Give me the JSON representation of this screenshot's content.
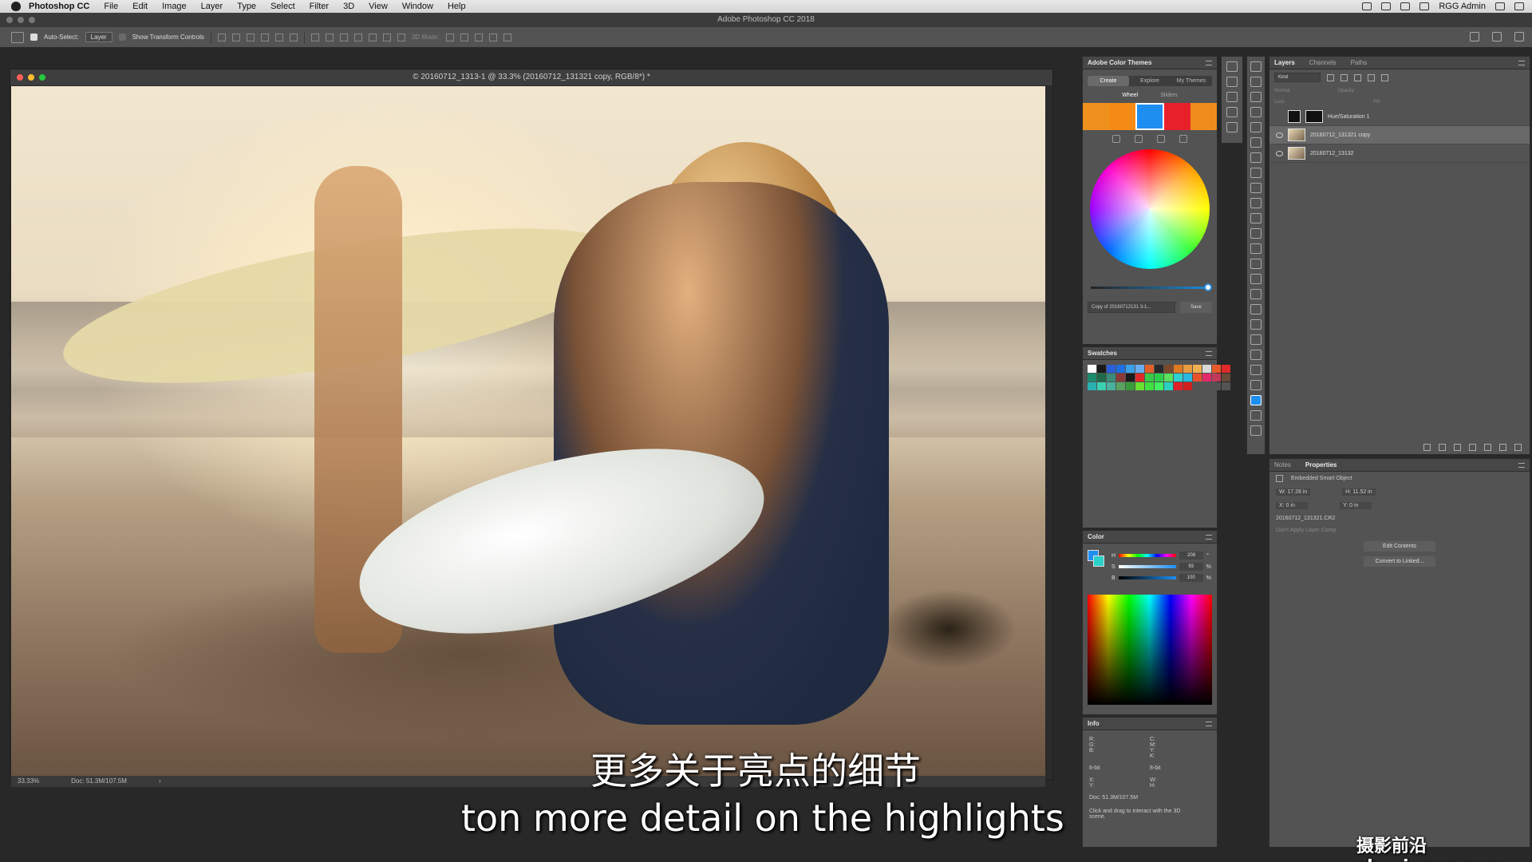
{
  "menubar": {
    "app_name": "Photoshop CC",
    "items": [
      "File",
      "Edit",
      "Image",
      "Layer",
      "Type",
      "Select",
      "Filter",
      "3D",
      "View",
      "Window",
      "Help"
    ],
    "user": "RGG Admin"
  },
  "window": {
    "title": "Adobe Photoshop CC 2018"
  },
  "options": {
    "auto_select_label": "Auto-Select:",
    "auto_select_value": "Layer",
    "transform_label": "Show Transform Controls",
    "mode_3d": "3D Mode:"
  },
  "document": {
    "title": "© 20160712_1313-1 @ 33.3% (20160712_131321 copy, RGB/8*) *",
    "zoom": "33.33%",
    "doc_size": "Doc: 51.3M/107.5M"
  },
  "subtitles": {
    "zh": "更多关于亮点的细节",
    "en": "ton more detail on the highlights",
    "watermark": "摄影前沿 sheyingyz.com"
  },
  "color_themes": {
    "title": "Adobe Color Themes",
    "tabs": [
      "Create",
      "Explore",
      "My Themes"
    ],
    "modes": [
      "Wheel",
      "Sliders"
    ],
    "theme_colors": [
      "#f0901e",
      "#f58a14",
      "#1e8ef0",
      "#e8202a",
      "#f08c1e"
    ],
    "theme_name": "Copy of 20160712131 3-1...",
    "save_label": "Save"
  },
  "swatches": {
    "title": "Swatches",
    "colors": [
      "#ffffff",
      "#1a1a1a",
      "#2b5fd9",
      "#1e6fe0",
      "#3aa0e8",
      "#6aaef0",
      "#e0622a",
      "#2a2a2a",
      "#7a4a2a",
      "#e07a20",
      "#e89a40",
      "#f0b050",
      "#d9d9d9",
      "#e85a2a",
      "#e02a2a",
      "#1a8a6a",
      "#1e6a4a",
      "#3a8a7a",
      "#8a3a3a",
      "#1a1a1a",
      "#e02a2a",
      "#3ac84a",
      "#2ad04a",
      "#5ae05a",
      "#30d0d0",
      "#28b8e0",
      "#e8502a",
      "#e02a6a",
      "#c03a5a",
      "#6a4a3a",
      "#2ab0b0",
      "#3ad0b0",
      "#4ab0a0",
      "#5aa060",
      "#3a9a3a",
      "#6ae030",
      "#40e040",
      "#40f060",
      "#2ad0c0",
      "#e0202a",
      "#d02020",
      "#535353",
      "#535353",
      "#535353",
      "#535353"
    ]
  },
  "color_panel": {
    "title": "Color",
    "rows": [
      {
        "label": "H",
        "value": "208",
        "unit": "°"
      },
      {
        "label": "S",
        "value": "93",
        "unit": "%"
      },
      {
        "label": "B",
        "value": "100",
        "unit": "%"
      }
    ],
    "fg_color": "#1e8ef0",
    "bg_color": "#2bd0c8"
  },
  "info": {
    "title": "Info",
    "rgb_labels": "R:\nG:\nB:",
    "bit_left": "8-bit",
    "cmyk_labels": "C:\nM:\nY:\nK:",
    "bit_right": "8-bit",
    "xy": "X:\nY:",
    "wh": "W:\nH:",
    "doc": "Doc: 51.3M/107.5M",
    "hint": "Click and drag to interact with the 3D scene."
  },
  "layers": {
    "tabs": [
      "Layers",
      "Channels",
      "Paths"
    ],
    "kind": "Kind",
    "blend": "Normal",
    "opacity": "Opacity:",
    "lock": "Lock:",
    "fill": "Fill:",
    "rows": [
      {
        "name": "Hue/Saturation 1",
        "visible": false,
        "adjustment": true
      },
      {
        "name": "20160712_131321 copy",
        "visible": true,
        "active": true
      },
      {
        "name": "20160712_13132",
        "visible": true
      }
    ]
  },
  "properties": {
    "tabs": [
      "Notes",
      "Properties"
    ],
    "type": "Embedded Smart Object",
    "w": "W: 17.28 in",
    "h": "H: 11.52 in",
    "x": "X: 0 in",
    "y": "Y: 0 in",
    "file": "20160712_131321.CR2",
    "layer_comp": "Don't Apply Layer Comp",
    "edit_contents": "Edit Contents",
    "convert": "Convert to Linked..."
  }
}
